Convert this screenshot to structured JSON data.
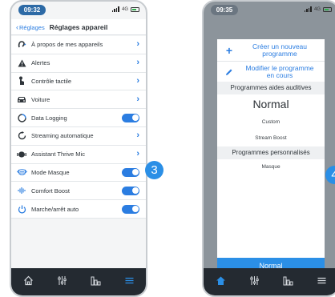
{
  "left_phone": {
    "time": "09:32",
    "network": "4G",
    "back_label": "Réglages",
    "title": "Réglages appareil",
    "rows": [
      {
        "label": "À propos de mes appareils",
        "icon": "ear-icon",
        "control": "chevron"
      },
      {
        "label": "Alertes",
        "icon": "alert-icon",
        "control": "chevron"
      },
      {
        "label": "Contrôle tactile",
        "icon": "touch-icon",
        "control": "chevron"
      },
      {
        "label": "Voiture",
        "icon": "car-icon",
        "control": "chevron"
      },
      {
        "label": "Data Logging",
        "icon": "data-logging-icon",
        "control": "toggle",
        "on": true
      },
      {
        "label": "Streaming automatique",
        "icon": "streaming-icon",
        "control": "chevron"
      },
      {
        "label": "Assistant Thrive Mic",
        "icon": "mic-icon",
        "control": "chevron"
      },
      {
        "label": "Mode Masque",
        "icon": "mask-icon",
        "control": "toggle",
        "on": true
      },
      {
        "label": "Comfort Boost",
        "icon": "comfort-boost-icon",
        "control": "toggle",
        "on": true
      },
      {
        "label": "Marche/arrêt auto",
        "icon": "power-icon",
        "control": "toggle",
        "on": true
      }
    ],
    "callout": "3"
  },
  "right_phone": {
    "time": "09:35",
    "network": "4G",
    "create_program": "Créer un nouveau programme",
    "modify_program": "Modifier le programme en cours",
    "hearing_programs_header": "Programmes aides auditives",
    "hearing_programs": [
      "Normal",
      "Custom",
      "Stream Boost"
    ],
    "custom_programs_header": "Programmes personnalisés",
    "custom_programs": [
      "Masque"
    ],
    "current_program_button": "Normal",
    "callout": "4"
  },
  "tabbar_icons": [
    "home-icon",
    "equalizer-icon",
    "bar-chart-icon",
    "menu-icon"
  ],
  "colors": {
    "accent": "#2b7de1",
    "callout": "#2b8fe6",
    "tabbar": "#242a31"
  }
}
